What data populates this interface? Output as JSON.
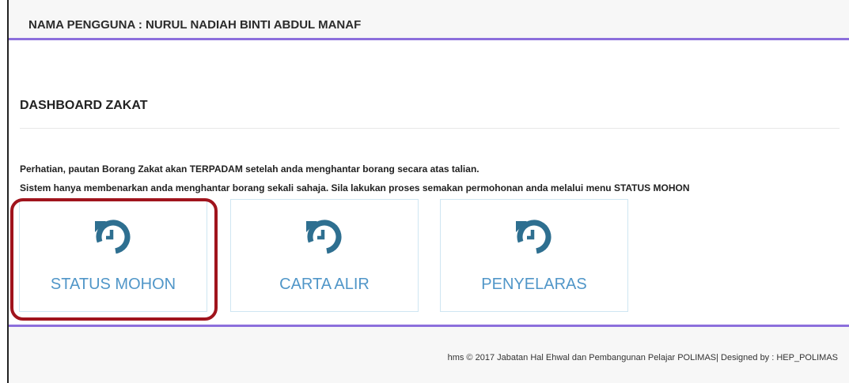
{
  "header": {
    "user_label": "NAMA PENGGUNA : NURUL NADIAH BINTI ABDUL MANAF"
  },
  "main": {
    "title": "DASHBOARD ZAKAT",
    "notice_1": "Perhatian, pautan Borang Zakat akan TERPADAM setelah anda menghantar borang secara atas talian.",
    "notice_2": "Sistem hanya membenarkan anda menghantar borang sekali sahaja. Sila lakukan proses semakan permohonan anda melalui menu STATUS MOHON",
    "cards": [
      {
        "label": "STATUS MOHON",
        "icon": "history-icon"
      },
      {
        "label": "CARTA ALIR",
        "icon": "history-icon"
      },
      {
        "label": "PENYELARAS",
        "icon": "history-icon"
      }
    ]
  },
  "footer": {
    "text": "hms © 2017 Jabatan Hal Ehwal dan Pembangunan Pelajar POLIMAS| Designed by : HEP_POLIMAS"
  },
  "colors": {
    "accent": "#8c6fdc",
    "icon": "#2e6f90",
    "label": "#5096c8",
    "highlight": "#a0141d"
  }
}
